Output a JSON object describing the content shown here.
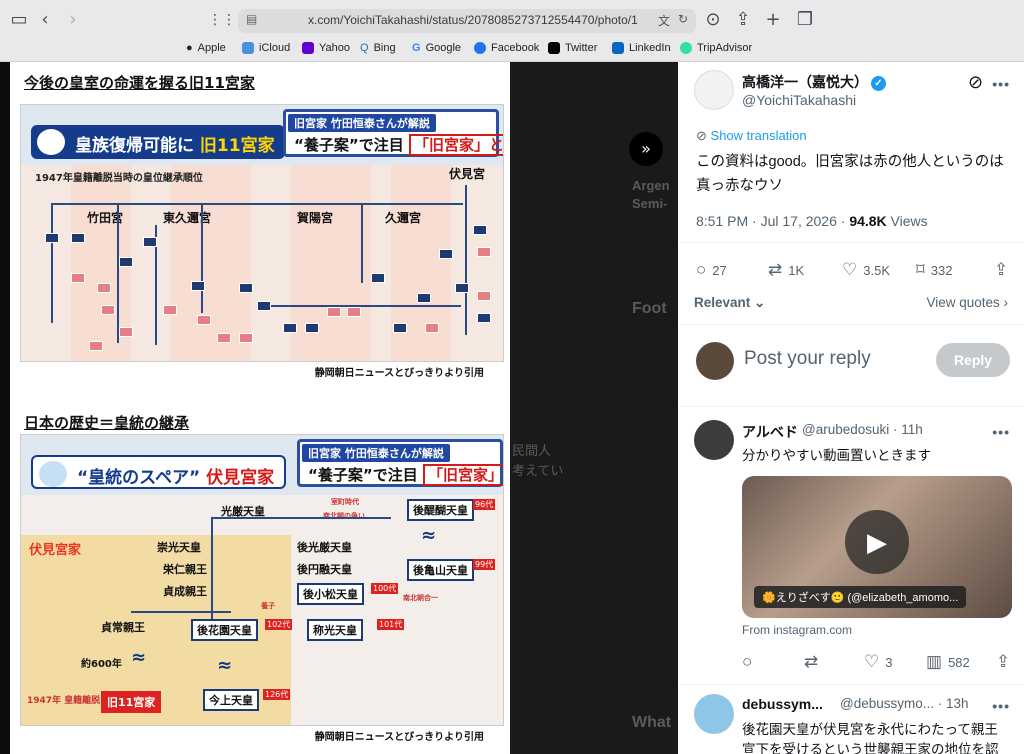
{
  "browser": {
    "url": "x.com/YoichiTakahashi/status/2078085273712554470/photo/1",
    "bookmarks": [
      "Apple",
      "iCloud",
      "Yahoo",
      "Bing",
      "Google",
      "Facebook",
      "Twitter",
      "LinkedIn",
      "TripAdvisor"
    ]
  },
  "photo": {
    "slide1": {
      "heading": "今後の皇室の命運を握る旧11宮家",
      "caption_top": "旧宮家 竹田恒泰さんが解説",
      "caption_main_a": "“養子案”で注目",
      "caption_main_b": "「旧宮家」とは",
      "title_a": "皇族復帰可能に",
      "title_b": "旧11宮家",
      "sub": "1947年皇籍離脱当時の皇位継承順位",
      "houses": [
        "竹田宮",
        "東久邇宮",
        "賀陽宮",
        "久邇宮",
        "伏見宮"
      ],
      "credit": "静岡朝日ニュースとびっきりより引用"
    },
    "slide2": {
      "heading": "日本の歴史＝皇統の継承",
      "caption_top": "旧宮家 竹田恒泰さんが解説",
      "caption_main_a": "“養子案”で注目",
      "caption_main_b": "「旧宮家」とは",
      "title_a": "“皇統のスペア”",
      "title_b": "伏見宮家",
      "fushimi_label": "伏見宮家",
      "era": "室町時代",
      "north_south": "南北朝の争い",
      "unify": "南北朝合一",
      "adopt": "養子",
      "years": "約600年",
      "left_tree": [
        "光厳天皇",
        "崇光天皇",
        "栄仁親王",
        "貞成親王",
        "貞常親王"
      ],
      "center_tree": [
        "後光厳天皇",
        "後円融天皇",
        "後小松天皇",
        "後花園天皇",
        "称光天皇",
        "今上天皇"
      ],
      "right_tree": [
        "後醍醐天皇",
        "後亀山天皇"
      ],
      "nums": [
        "96代",
        "99代",
        "100代",
        "101代",
        "102代",
        "126代"
      ],
      "bottom_a": "1947年 皇籍離脱",
      "bottom_b": "旧11宮家",
      "credit": "静岡朝日ニュースとびっきりより引用"
    }
  },
  "background_text": {
    "b1": "Argen",
    "b2": "Semi-",
    "b3": "Foot",
    "b4": "What",
    "b5": "民間人",
    "b6": "考えてい"
  },
  "tweet": {
    "author_name": "高橋洋一（嘉悦大）",
    "author_handle": "@YoichiTakahashi",
    "show_translation": "Show translation",
    "text": "この資料はgood。旧宮家は赤の他人というのは真っ赤なウソ",
    "time": "8:51 PM · Jul 17, 2026 · ",
    "views_count": "94.8K",
    "views_label": " Views",
    "replies": "27",
    "reposts": "1K",
    "likes": "3.5K",
    "bookmarks": "332",
    "relevant": "Relevant",
    "view_quotes": "View quotes",
    "post_reply_placeholder": "Post your reply",
    "reply_button": "Reply"
  },
  "replies": [
    {
      "name": "アルベド",
      "handle": "@arubedosuki · 11h",
      "text": "分かりやすい動画置いときます",
      "card_tag": "🌼えりざべす🙂 (@elizabeth_amomo...",
      "card_from": "From instagram.com",
      "reposts": "",
      "likes": "3",
      "views": "582"
    },
    {
      "name": "debussym...",
      "handle": "@debussymo... · 13h",
      "text_1": "後花園天皇が伏見宮を永代にわたって親王",
      "text_2": "宣下を受けるという世襲親王家の地位を認"
    }
  ],
  "colors": {
    "accent": "#1d9bf0",
    "tv_blue": "#143b8c",
    "red": "#d61919"
  }
}
